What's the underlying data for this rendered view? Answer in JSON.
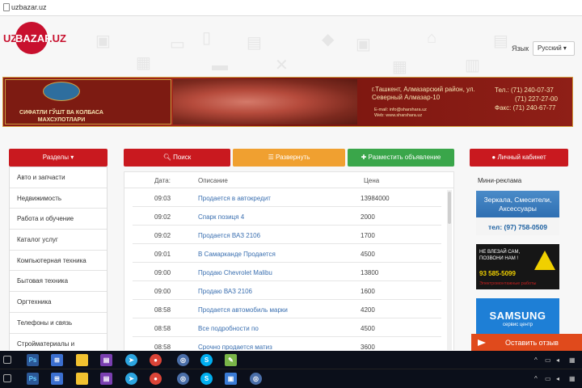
{
  "browser": {
    "url": "uzbazar.uz"
  },
  "logo": {
    "uz": "UZ",
    "bazar": "BAZAR",
    "tld": ".UZ"
  },
  "language": {
    "label": "Язык",
    "selected": "Русский ▾"
  },
  "banner": {
    "left_text": "СИФАТЛИ ГЎШТ ВА КОЛБАСА МАХСУЛОТЛАРИ",
    "address": "г.Ташкент, Алмазарский район, ул. Северный Алмазар-10",
    "email": "E-mail: info@sharshara.uz",
    "web": "Web: www.sharshara.uz",
    "phone_label_1": "Тел.: (71) 240-07-37",
    "phone_2": "(71) 227-27-00",
    "fax": "Факс: (71) 240-67-77"
  },
  "sidebar": {
    "header": "Разделы ▾",
    "items": [
      {
        "label": "Авто и запчасти"
      },
      {
        "label": "Недвижимость"
      },
      {
        "label": "Работа и обучение"
      },
      {
        "label": "Каталог услуг"
      },
      {
        "label": "Компьютерная техника"
      },
      {
        "label": "Бытовая техника"
      },
      {
        "label": "Оргтехника"
      },
      {
        "label": "Телефоны и связь"
      },
      {
        "label": "Стройматериалы и"
      }
    ]
  },
  "toolbar": {
    "search_label": "Поиск",
    "expand_label": "Развернуть",
    "post_label": "Разместить объявление"
  },
  "ads_table": {
    "headers": {
      "date": "Дата:",
      "description": "Описание",
      "price": "Цена"
    },
    "rows": [
      {
        "time": "09:03",
        "desc": "Продается в автокредит",
        "price": "13984000"
      },
      {
        "time": "09:02",
        "desc": "Спарк позиця 4",
        "price": "2000"
      },
      {
        "time": "09:02",
        "desc": "Продается ВАЗ 2106",
        "price": "1700"
      },
      {
        "time": "09:01",
        "desc": "В Самарканде Продается",
        "price": "4500"
      },
      {
        "time": "09:00",
        "desc": "Продаю Chevrolet Malibu",
        "price": "13800"
      },
      {
        "time": "09:00",
        "desc": "Продаю ВАЗ 2106",
        "price": "1600"
      },
      {
        "time": "08:58",
        "desc": "Продается автомобиль марки",
        "price": "4200"
      },
      {
        "time": "08:58",
        "desc": "Все подробности по",
        "price": "4500"
      },
      {
        "time": "08:58",
        "desc": "Срочно продается матиз",
        "price": "3600"
      }
    ]
  },
  "right_panel": {
    "cabinet_label": "Личный кабинет",
    "mini_label": "Мини-реклама",
    "ad1_title": "Зеркала, Смесители, Аксессуары",
    "ad1_phone": "тел: (97) 758-0509",
    "ad2_text": "НЕ ВЛЕЗАЙ САМ, ПОЗВОНИ НАМ !",
    "ad2_phone": "93 585-5099",
    "ad2_sub": "Электромонтажные работы",
    "ad3_brand": "SAMSUNG",
    "ad3_sub": "сервис центр"
  },
  "feedback": {
    "label": "Оставить отзыв"
  }
}
